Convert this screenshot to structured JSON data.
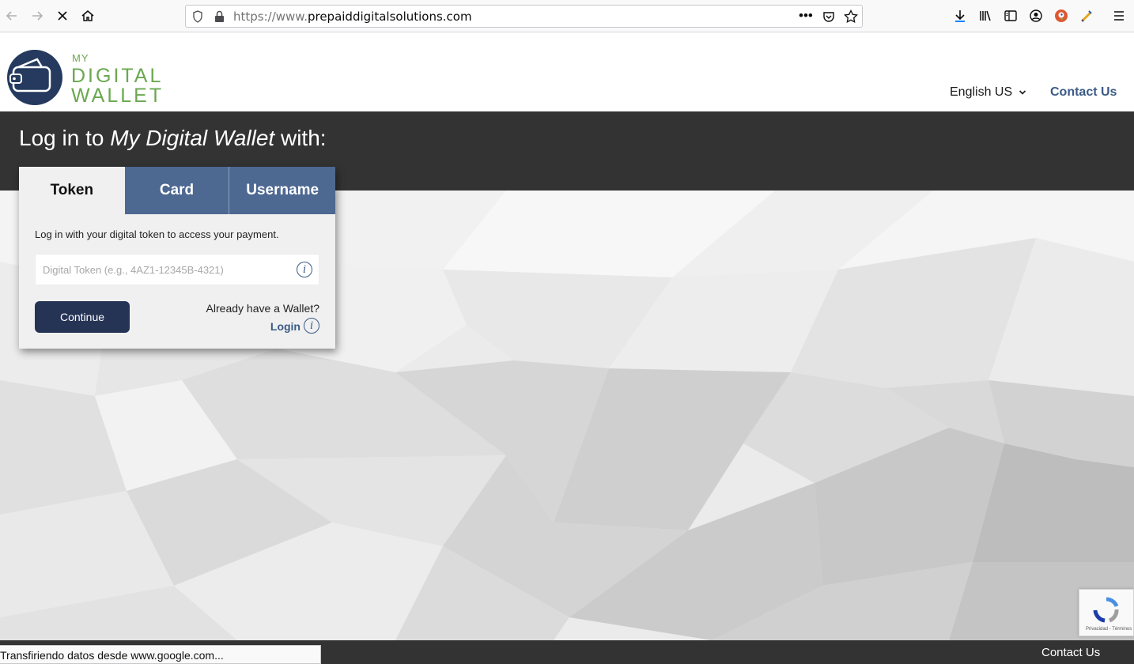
{
  "browser": {
    "url_prefix": "https://www.",
    "url_host": "prepaiddigitalsolutions.com",
    "status_text": "Transfiriendo datos desde www.google.com..."
  },
  "header": {
    "logo_my": "MY",
    "logo_digital": "DIGITAL",
    "logo_wallet": "WALLET",
    "language": "English US",
    "contact": "Contact Us"
  },
  "hero": {
    "title_prefix": "Log in to ",
    "title_brand": "My Digital Wallet",
    "title_suffix": " with:"
  },
  "login": {
    "tabs": [
      {
        "label": "Token",
        "active": true
      },
      {
        "label": "Card",
        "active": false
      },
      {
        "label": "Username",
        "active": false
      }
    ],
    "description": "Log in with your digital token to access your payment.",
    "token_placeholder": "Digital Token (e.g., 4AZ1-12345B-4321)",
    "token_value": "",
    "continue_label": "Continue",
    "already_text": "Already have a Wallet?",
    "login_label": "Login"
  },
  "footer": {
    "contact": "Contact Us"
  },
  "recaptcha": {
    "privacy": "Privacidad",
    "terms": "Términos"
  },
  "colors": {
    "brand_navy": "#253a5e",
    "brand_green": "#6aa84f",
    "tab_inactive": "#4d6891",
    "link_blue": "#3b5a86",
    "dark_band": "#333333",
    "button": "#253355"
  }
}
